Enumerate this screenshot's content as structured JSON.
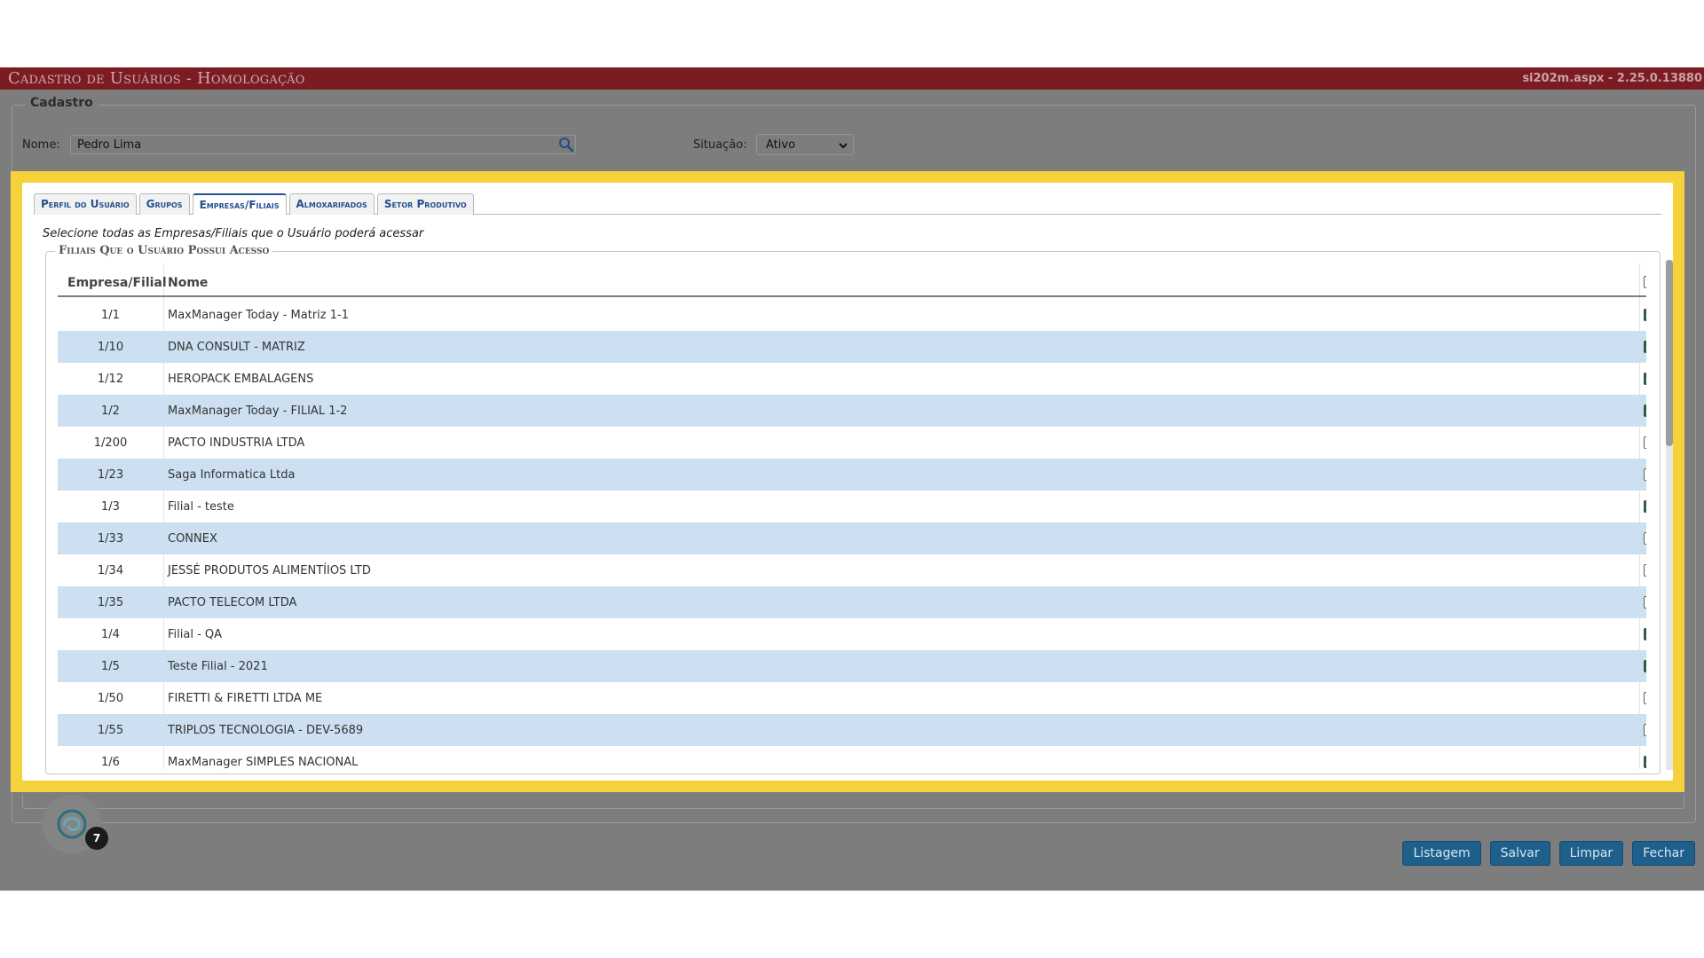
{
  "titlebar": {
    "title": "Cadastro de Usuários  - Homologação",
    "version": "si202m.aspx - 2.25.0.13880"
  },
  "cadastro": {
    "legend": "Cadastro",
    "nome_label": "Nome:",
    "nome_value": "Pedro Lima",
    "situacao_label": "Situação:",
    "situacao_value": "Ativo"
  },
  "tabs": [
    {
      "label": "Perfil do Usuário",
      "active": false
    },
    {
      "label": "Grupos",
      "active": false
    },
    {
      "label": "Empresas/Filiais",
      "active": true
    },
    {
      "label": "Almoxarifados",
      "active": false
    },
    {
      "label": "Setor Produtivo",
      "active": false
    }
  ],
  "hint": "Selecione todas as Empresas/Filiais que o Usuário poderá acessar",
  "filiais": {
    "legend": "Filiais Que o Usuário Possui Acesso",
    "col_code": "Empresa/Filial",
    "col_name": "Nome",
    "select_all_checked": false,
    "rows": [
      {
        "code": "1/1",
        "name": "MaxManager Today - Matriz 1-1",
        "checked": true
      },
      {
        "code": "1/10",
        "name": "DNA CONSULT - MATRIZ",
        "checked": true
      },
      {
        "code": "1/12",
        "name": "HEROPACK EMBALAGENS",
        "checked": true
      },
      {
        "code": "1/2",
        "name": "MaxManager Today - FILIAL 1-2",
        "checked": true
      },
      {
        "code": "1/200",
        "name": "PACTO INDUSTRIA LTDA",
        "checked": false
      },
      {
        "code": "1/23",
        "name": "Saga Informatica Ltda",
        "checked": false
      },
      {
        "code": "1/3",
        "name": "Filial - teste",
        "checked": true
      },
      {
        "code": "1/33",
        "name": "CONNEX",
        "checked": false
      },
      {
        "code": "1/34",
        "name": "JESSÉ PRODUTOS ALIMENTÍIOS LTD",
        "checked": false
      },
      {
        "code": "1/35",
        "name": "PACTO TELECOM LTDA",
        "checked": false
      },
      {
        "code": "1/4",
        "name": "Filial - QA",
        "checked": true
      },
      {
        "code": "1/5",
        "name": "Teste Filial - 2021",
        "checked": true
      },
      {
        "code": "1/50",
        "name": "FIRETTI & FIRETTI LTDA ME",
        "checked": false
      },
      {
        "code": "1/55",
        "name": "TRIPLOS TECNOLOGIA - DEV-5689",
        "checked": false
      },
      {
        "code": "1/6",
        "name": "MaxManager SIMPLES NACIONAL",
        "checked": true
      }
    ]
  },
  "badge_count": "7",
  "buttons": {
    "listagem": "Listagem",
    "salvar": "Salvar",
    "limpar": "Limpar",
    "fechar": "Fechar"
  },
  "icons": {
    "search": "magnifier-icon",
    "dropdown": "chevron-down-icon",
    "logo": "swirl-logo-icon"
  }
}
